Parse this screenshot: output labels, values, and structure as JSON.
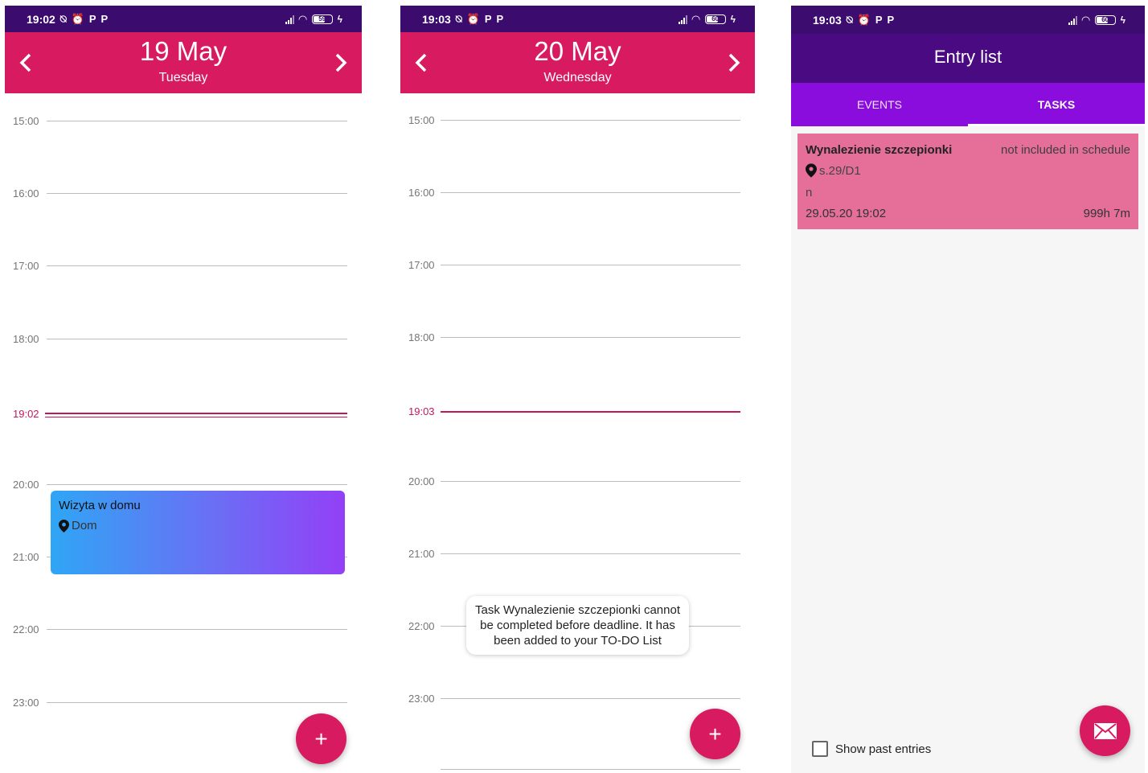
{
  "screens": [
    {
      "status": {
        "time": "19:02",
        "battery": "59"
      },
      "header": {
        "date": "19 May",
        "weekday": "Tuesday"
      },
      "hours": [
        "15:00",
        "16:00",
        "17:00",
        "18:00",
        "20:00",
        "21:00",
        "22:00",
        "23:00"
      ],
      "now_label": "19:02",
      "event": {
        "title": "Wizyta w domu",
        "location": "Dom"
      },
      "fab_label": "+"
    },
    {
      "status": {
        "time": "19:03",
        "battery": "60"
      },
      "header": {
        "date": "20 May",
        "weekday": "Wednesday"
      },
      "hours": [
        "15:00",
        "16:00",
        "17:00",
        "18:00",
        "20:00",
        "21:00",
        "22:00",
        "23:00"
      ],
      "now_label": "19:03",
      "toast": "Task Wynalezienie szczepionki cannot be completed before deadline. It has been added to your TO-DO List",
      "fab_label": "+"
    },
    {
      "status": {
        "time": "19:03",
        "battery": "60"
      },
      "title": "Entry list",
      "tabs": [
        {
          "label": "EVENTS",
          "active": false
        },
        {
          "label": "TASKS",
          "active": true
        }
      ],
      "task": {
        "title": "Wynalezienie szczepionki",
        "status": "not included in schedule",
        "location": "s.29/D1",
        "description": "n",
        "deadline": "29.05.20 19:02",
        "duration": "999h 7m"
      },
      "show_past_label": "Show past entries",
      "show_past_checked": false
    }
  ],
  "colors": {
    "statusbar": "#3b0b6e",
    "day_header": "#d81b60",
    "appbar": "#4a0a82",
    "tabs": "#8a0ddd",
    "task_card": "#e56f99",
    "now_line": "#c2185b",
    "fab": "#d81b60"
  }
}
